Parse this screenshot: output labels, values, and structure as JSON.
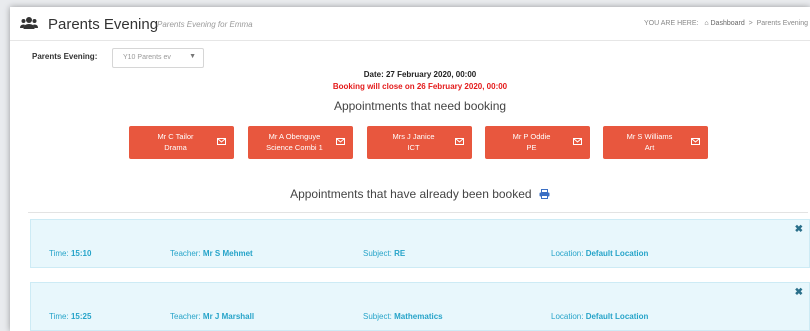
{
  "header": {
    "title": "Parents Evening",
    "subtitle": "Parents Evening for Emma",
    "breadcrumb": {
      "prefix": "YOU ARE HERE:",
      "home": "Dashboard",
      "separator": ">",
      "current": "Parents Evening"
    }
  },
  "filter": {
    "label": "Parents Evening:",
    "selected": "Y10 Parents ev"
  },
  "event": {
    "date": "Date: 27 February 2020, 00:00",
    "booking_close": "Booking will close on 26 February 2020, 00:00"
  },
  "need_booking": {
    "heading": "Appointments that need booking",
    "teachers": [
      {
        "name": "Mr C Tailor",
        "subject": "Drama"
      },
      {
        "name": "Mr A Obenguye",
        "subject": "Science Combi 1"
      },
      {
        "name": "Mrs J Janice",
        "subject": "ICT"
      },
      {
        "name": "Mr P Oddie",
        "subject": "PE"
      },
      {
        "name": "Mr S Williams",
        "subject": "Art"
      }
    ]
  },
  "booked": {
    "heading": "Appointments that have already been booked",
    "labels": {
      "time": "Time:",
      "teacher": "Teacher:",
      "subject": "Subject:",
      "location": "Location:"
    },
    "appointments": [
      {
        "time": "15:10",
        "teacher": "Mr S Mehmet",
        "subject": "RE",
        "location": "Default Location"
      },
      {
        "time": "15:25",
        "teacher": "Mr J Marshall",
        "subject": "Mathematics",
        "location": "Default Location"
      }
    ]
  },
  "colors": {
    "accent_button": "#e8573e",
    "warning_text": "#e41b1b",
    "appointment_bg": "#e8f7fc",
    "appointment_text": "#27a4c9"
  },
  "icons": {
    "header": "users-icon",
    "teacher_button": "envelope-icon",
    "booked_heading": "print-icon",
    "remove": "close-icon"
  }
}
